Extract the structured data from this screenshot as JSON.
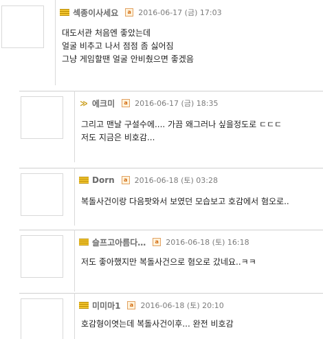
{
  "comments": [
    {
      "nick": "섹종이사세요",
      "rank_icon": "rank-bars-icon",
      "date": "2016-06-17 (금) 17:03",
      "lines": [
        "대도서관 처음엔 좋았는데",
        "얼굴 비추고 나서 점점 좀 싫어짐",
        "그냥 게임할땐 얼굴 안비췄으면 좋겠음"
      ]
    },
    {
      "nick": "에크미",
      "rank_icon": "rank-wing-icon",
      "date": "2016-06-17 (금) 18:35",
      "lines": [
        "그리고 맨날 구설수에.... 가끔 왜그러나 싶을정도로 ㄷㄷㄷ",
        "저도 지금은 비호감..."
      ]
    },
    {
      "nick": "Dorn",
      "rank_icon": "rank-bars-icon",
      "date": "2016-06-18 (토) 03:28",
      "lines": [
        "복돌사건이랑 다음팟와서 보였던 모습보고 호감에서 혐오로.."
      ]
    },
    {
      "nick": "슬프고아름다…",
      "rank_icon": "rank-bars-icon",
      "date": "2016-06-18 (토) 16:18",
      "lines": [
        "저도 좋아했지만 복돌사건으로 혐오로 갔네요..ㅋㅋ"
      ]
    },
    {
      "nick": "미미마1",
      "rank_icon": "rank-bars-icon",
      "date": "2016-06-18 (토) 20:10",
      "lines": [
        "호감형이엿는데 복돌사건이후... 완전 비호감"
      ]
    }
  ]
}
